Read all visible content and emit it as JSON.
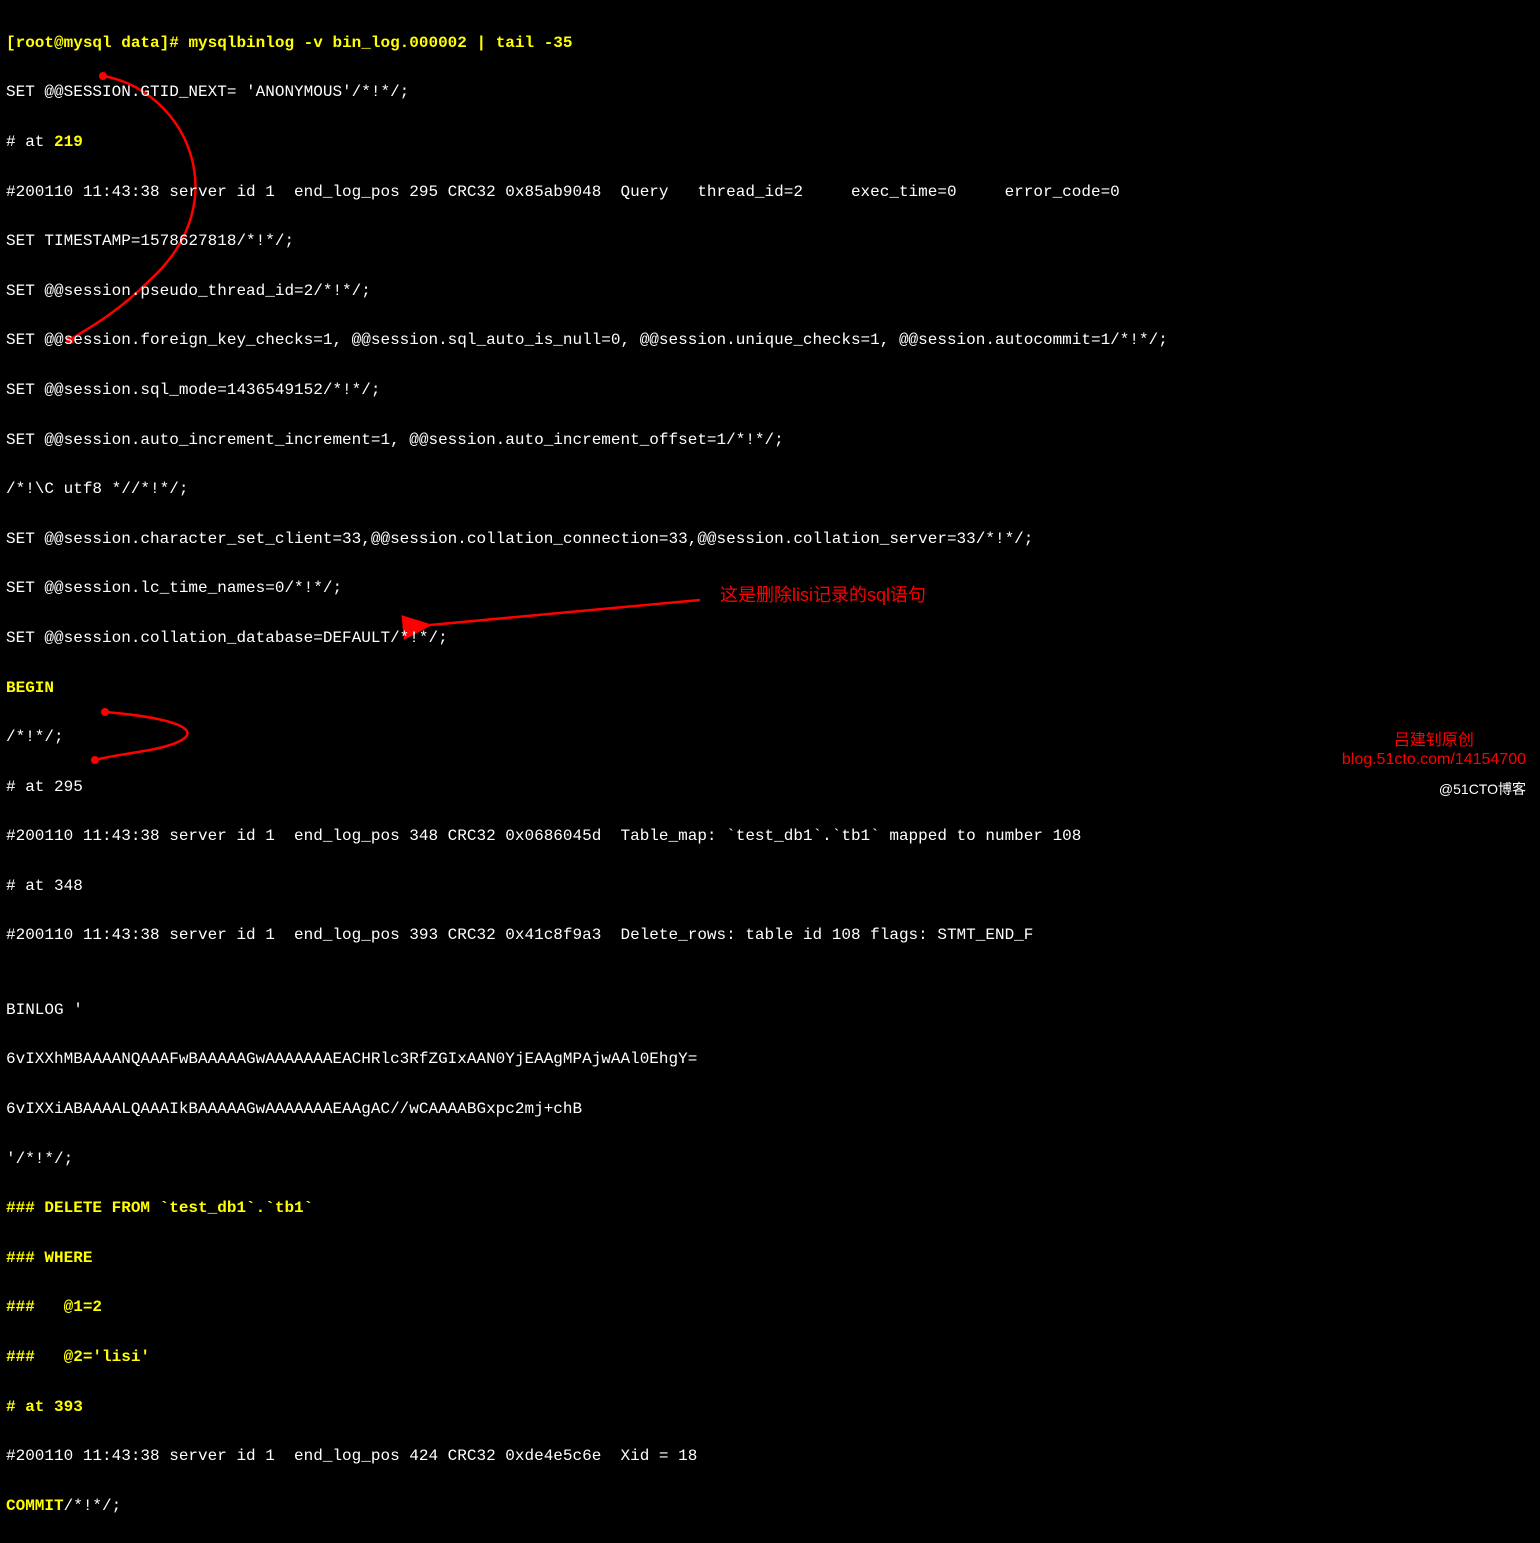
{
  "prompt": {
    "user_host": "[root@mysql data]# ",
    "command": "mysqlbinlog -v bin_log.000002 | tail -35"
  },
  "lines": {
    "l1a": "SET @@SESSION.GTID_NEXT= 'ANONYMOUS'/*!*/;",
    "l2a": "# at ",
    "l2b": "219",
    "l3": "#200110 11:43:38 server id 1  end_log_pos 295 CRC32 0x85ab9048  Query   thread_id=2     exec_time=0     error_code=0",
    "l4": "SET TIMESTAMP=1578627818/*!*/;",
    "l5": "SET @@session.pseudo_thread_id=2/*!*/;",
    "l6": "SET @@session.foreign_key_checks=1, @@session.sql_auto_is_null=0, @@session.unique_checks=1, @@session.autocommit=1/*!*/;",
    "l7": "SET @@session.sql_mode=1436549152/*!*/;",
    "l8": "SET @@session.auto_increment_increment=1, @@session.auto_increment_offset=1/*!*/;",
    "l9": "/*!\\C utf8 *//*!*/;",
    "l10": "SET @@session.character_set_client=33,@@session.collation_connection=33,@@session.collation_server=33/*!*/;",
    "l11": "SET @@session.lc_time_names=0/*!*/;",
    "l12": "SET @@session.collation_database=DEFAULT/*!*/;",
    "l13": "BEGIN",
    "l14": "/*!*/;",
    "l15": "# at 295",
    "l16": "#200110 11:43:38 server id 1  end_log_pos 348 CRC32 0x0686045d  Table_map: `test_db1`.`tb1` mapped to number 108",
    "l17": "# at 348",
    "l18": "#200110 11:43:38 server id 1  end_log_pos 393 CRC32 0x41c8f9a3  Delete_rows: table id 108 flags: STMT_END_F",
    "l19": "",
    "l20": "BINLOG '",
    "l21": "6vIXXhMBAAAANQAAAFwBAAAAAGwAAAAAAAEACHRlc3RfZGIxAAN0YjEAAgMPAjwAAl0EhgY=",
    "l22": "6vIXXiABAAAALQAAAIkBAAAAAGwAAAAAAAEAAgAC//wCAAAABGxpc2mj+chB",
    "l23": "'/*!*/;",
    "l24": "### DELETE FROM `test_db1`.`tb1`",
    "l25": "### WHERE",
    "l26": "###   @1=2",
    "l27": "###   @2='lisi'",
    "l28": "# at 393",
    "l29": "#200110 11:43:38 server id 1  end_log_pos 424 CRC32 0xde4e5c6e  Xid = 18",
    "l30a": "COMMIT",
    "l30b": "/*!*/;"
  },
  "annotation": {
    "text": "这是删除lisi记录的sql语句"
  },
  "watermark": {
    "line1": "吕建钊原创",
    "line2": "blog.51cto.com/14154700"
  },
  "footer": {
    "brand": "@51CTO博客"
  }
}
